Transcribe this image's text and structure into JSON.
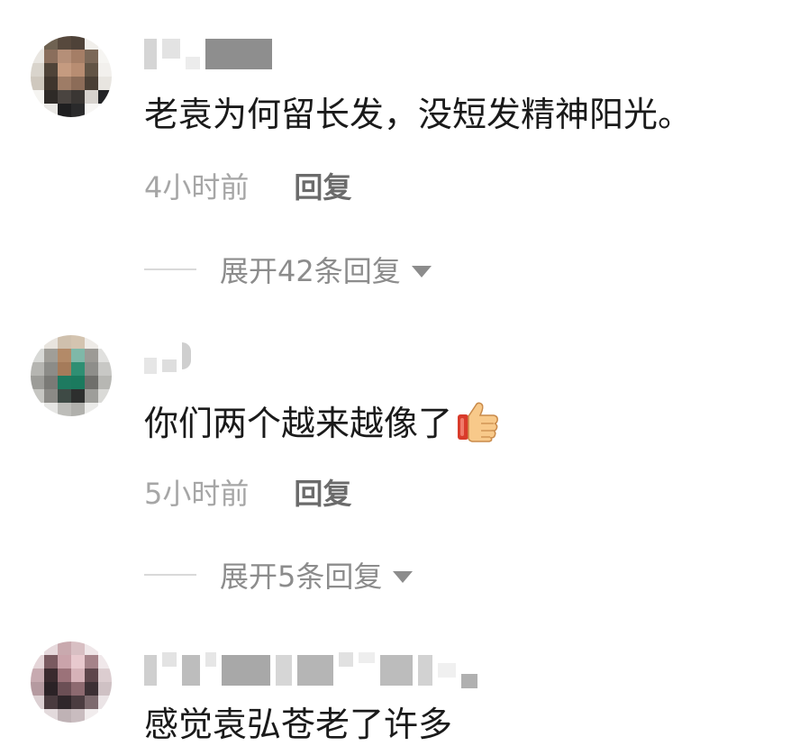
{
  "comments": [
    {
      "text": "老袁为何留长发，没短发精神阳光。",
      "time": "4小时前",
      "reply_label": "回复",
      "expand_label": "展开42条回复"
    },
    {
      "text": "你们两个越来越像了",
      "emoji": "thumbs-up-icon",
      "time": "5小时前",
      "reply_label": "回复",
      "expand_label": "展开5条回复"
    },
    {
      "text": "感觉袁弘苍老了许多"
    }
  ]
}
